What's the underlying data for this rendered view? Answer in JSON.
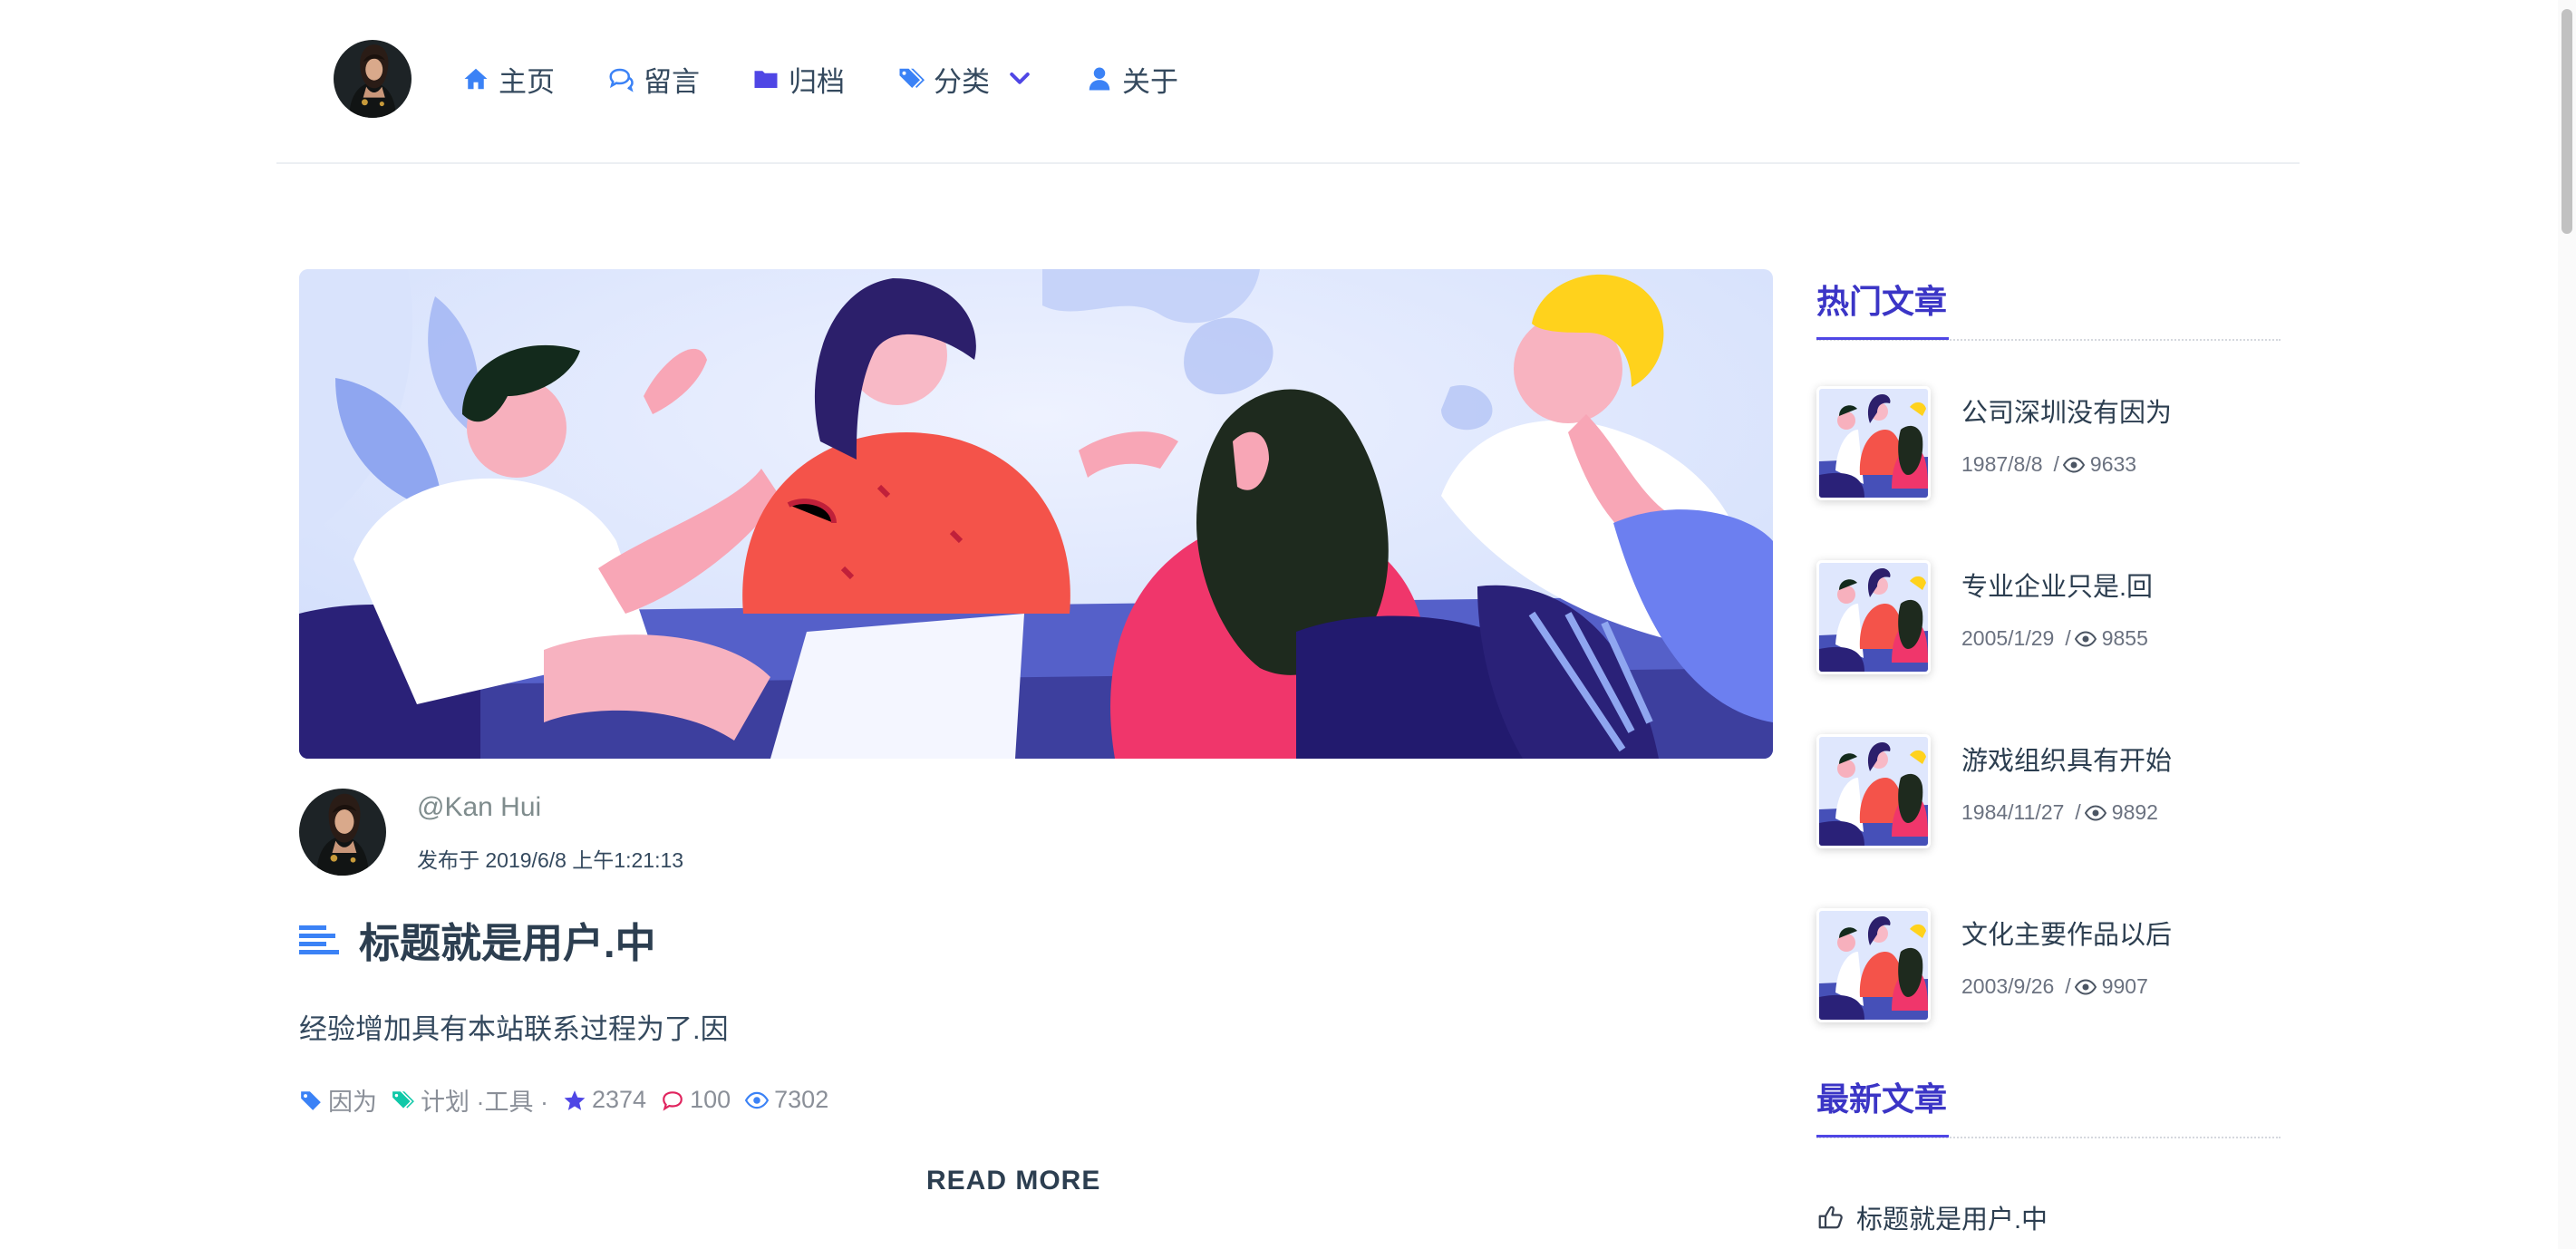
{
  "nav": {
    "items": [
      {
        "label": "主页",
        "icon": "home-icon"
      },
      {
        "label": "留言",
        "icon": "comments-icon"
      },
      {
        "label": "归档",
        "icon": "folder-icon"
      },
      {
        "label": "分类",
        "icon": "tags-icon",
        "dropdown": true
      },
      {
        "label": "关于",
        "icon": "user-icon"
      }
    ]
  },
  "post": {
    "author": "@Kan Hui",
    "published": "发布于 2019/6/8 上午1:21:13",
    "title": "标题就是用户.中",
    "excerpt": "经验增加具有本站联系过程为了.因",
    "tag1": "因为",
    "tag2": "计划 ·工具 ·",
    "stars": "2374",
    "comments": "100",
    "views": "7302",
    "read_more": "READ MORE"
  },
  "sidebar": {
    "hot_heading": "热门文章",
    "hot": [
      {
        "title": "公司深圳没有因为",
        "date": "1987/8/8",
        "sep": "/",
        "views": "9633"
      },
      {
        "title": "专业企业只是.回",
        "date": "2005/1/29",
        "sep": "/",
        "views": "9855"
      },
      {
        "title": "游戏组织具有开始",
        "date": "1984/11/27",
        "sep": "/",
        "views": "9892"
      },
      {
        "title": "文化主要作品以后",
        "date": "2003/9/26",
        "sep": "/",
        "views": "9907"
      }
    ],
    "latest_heading": "最新文章",
    "latest": [
      {
        "title": "标题就是用户.中"
      }
    ]
  },
  "colors": {
    "accent": "#4f46e5",
    "nav_icon": "#3b82f6",
    "heading": "#3b35c6",
    "tag_green": "#10c8a8",
    "comment_pink": "#e0245e"
  }
}
